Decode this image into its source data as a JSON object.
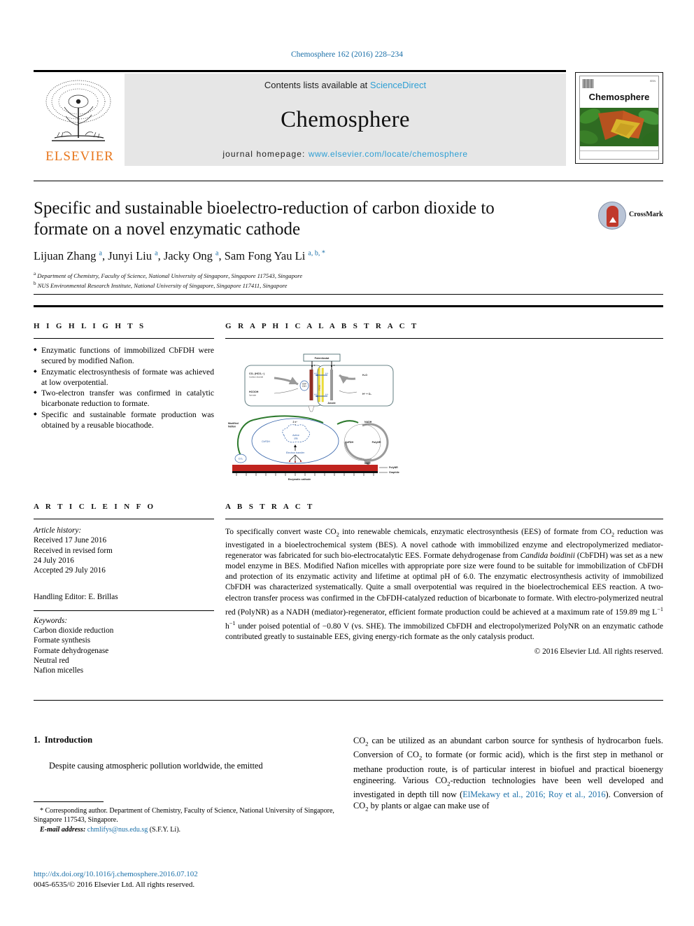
{
  "running_head": "Chemosphere 162 (2016) 228–234",
  "masthead": {
    "contents_prefix": "Contents lists available at ",
    "contents_link": "ScienceDirect",
    "journal_name": "Chemosphere",
    "homepage_prefix": "journal homepage: ",
    "homepage_url": "www.elsevier.com/locate/chemosphere",
    "publisher": "ELSEVIER",
    "cover_title": "Chemosphere",
    "accent_blue": "#2E9FD4",
    "elsevier_orange": "#E8761C"
  },
  "title": "Specific and sustainable bioelectro-reduction of carbon dioxide to formate on a novel enzymatic cathode",
  "crossmark_label": "CrossMark",
  "authors": [
    {
      "name": "Lijuan Zhang",
      "marks": "a"
    },
    {
      "name": "Junyi Liu",
      "marks": "a"
    },
    {
      "name": "Jacky Ong",
      "marks": "a"
    },
    {
      "name": "Sam Fong Yau Li",
      "marks": "a, b, *"
    }
  ],
  "affiliations": [
    {
      "mark": "a",
      "text": "Department of Chemistry, Faculty of Science, National University of Singapore, Singapore 117543, Singapore"
    },
    {
      "mark": "b",
      "text": "NUS Environmental Research Institute, National University of Singapore, Singapore 117411, Singapore"
    }
  ],
  "highlights": {
    "heading": "H I G H L I G H T S",
    "items": [
      "Enzymatic functions of immobilized CbFDH were secured by modified Nafion.",
      "Enzymatic electrosynthesis of formate was achieved at low overpotential.",
      "Two-electron transfer was confirmed in catalytic bicarbonate reduction to formate.",
      "Specific and sustainable formate production was obtained by a reusable biocathode."
    ]
  },
  "graphical_abstract": {
    "heading": "G R A P H I C A L   A B S T R A C T",
    "figure_labels": {
      "potentiostat": "Potentiostat",
      "co2": "CO₂ (HCO₃⁻)",
      "co2_sub": "Carbon dioxide",
      "hcooh": "HCOOH",
      "hcooh_sub": "formate",
      "pem": "PEM",
      "h2o": "H₂O",
      "h_o2": "H⁺ + O₂",
      "anode": "Anode",
      "proton_left": "H⁺",
      "proton_right": "H⁺",
      "modified_nafion": "Modified Nafion",
      "two_e": "2 e⁻",
      "active_site": "Active site",
      "cbfdh": "CbFDH",
      "electron_transfer": "Electron transfer",
      "nadh": "NADH",
      "nad": "NAD⁺",
      "polynr_cycle": "PolyNR",
      "cbfdh_cycle": "CbFDH",
      "polynr_layer": "PolyNR",
      "graphite": "Graphite",
      "enzymatic_cathode": "Enzymatic cathode",
      "small_circle": "CO₂"
    }
  },
  "article_info": {
    "heading": "A R T I C L E   I N F O",
    "history_label": "Article history:",
    "history_lines": [
      "Received 17 June 2016",
      "Received in revised form",
      "24 July 2016",
      "Accepted 29 July 2016"
    ],
    "handling_editor": "Handling Editor: E. Brillas",
    "keywords_label": "Keywords:",
    "keywords": [
      "Carbon dioxide reduction",
      "Formate synthesis",
      "Formate dehydrogenase",
      "Neutral red",
      "Nafion micelles"
    ]
  },
  "abstract": {
    "heading": "A B S T R A C T",
    "paragraphs": [
      "To specifically convert waste CO2 into renewable chemicals, enzymatic electrosynthesis (EES) of formate from CO2 reduction was investigated in a bioelectrochemical system (BES). A novel cathode with immobilized enzyme and electropolymerized mediator-regenerator was fabricated for such bio-electrocatalytic EES. Formate dehydrogenase from Candida boidinii (CbFDH) was set as a new model enzyme in BES. Modified Nafion micelles with appropriate pore size were found to be suitable for immobilization of CbFDH and protection of its enzymatic activity and lifetime at optimal pH of 6.0. The enzymatic electrosynthesis activity of immobilized CbFDH was characterized systematically. Quite a small overpotential was required in the bioelectrochemical EES reaction. A two-electron transfer process was confirmed in the CbFDH-catalyzed reduction of bicarbonate to formate. With electro-polymerized neutral red (PolyNR) as a NADH (mediator)-regenerator, efficient formate production could be achieved at a maximum rate of 159.89 mg L-1 h-1 under poised potential of -0.80 V (vs. SHE). The immobilized CbFDH and electropolymerized PolyNR on an enzymatic cathode contributed greatly to sustainable EES, giving energy-rich formate as the only catalysis product."
    ],
    "copyright": "© 2016 Elsevier Ltd. All rights reserved."
  },
  "introduction": {
    "heading_number": "1.",
    "heading_text": "Introduction",
    "first_paragraph": "Despite causing atmospheric pollution worldwide, the emitted"
  },
  "footnote": {
    "corresponding": "* Corresponding author. Department of Chemistry, Faculty of Science, National University of Singapore, Singapore 117543, Singapore.",
    "email_label": "E-mail address:",
    "email": "chmlifys@nus.edu.sg",
    "email_owner": "(S.F.Y. Li)."
  },
  "right_column": {
    "text_before_cite": "CO2 can be utilized as an abundant carbon source for synthesis of hydrocarbon fuels. Conversion of CO2 to formate (or formic acid), which is the first step in methanol or methane production route, is of particular interest in biofuel and practical bioenergy engineering. Various CO2-reduction technologies have been well developed and investigated in depth till now (",
    "citation": "ElMekawy et al., 2016; Roy et al., 2016",
    "text_after_cite": "). Conversion of CO2 by plants or algae can make use of"
  },
  "footer": {
    "doi": "http://dx.doi.org/10.1016/j.chemosphere.2016.07.102",
    "issn_line": "0045-6535/© 2016 Elsevier Ltd. All rights reserved."
  }
}
